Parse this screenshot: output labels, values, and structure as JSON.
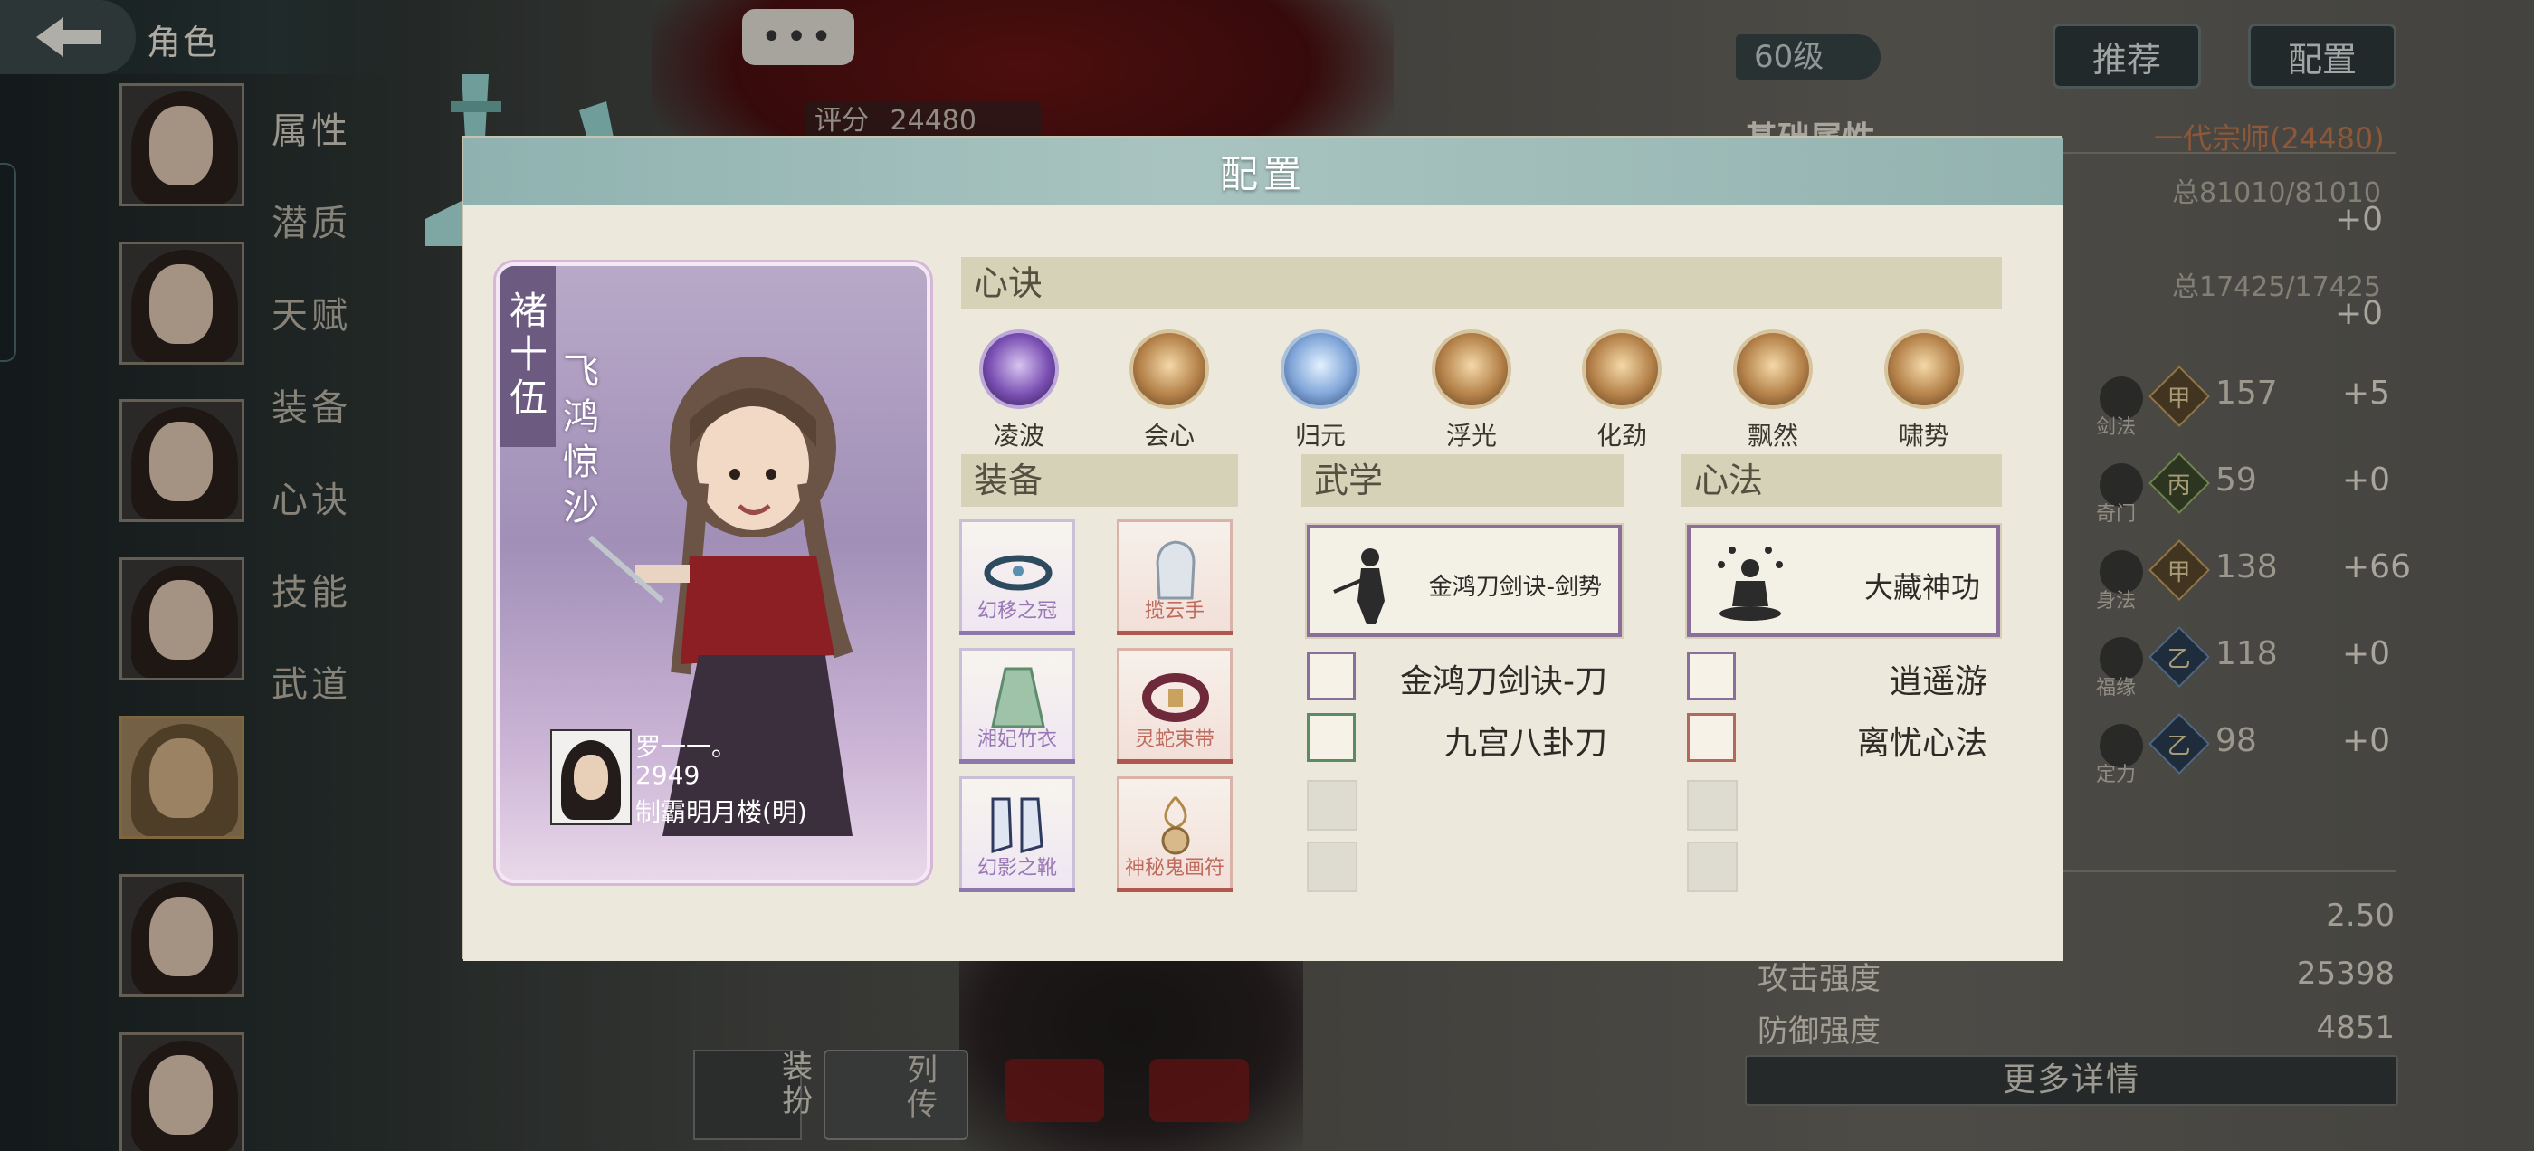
{
  "header": {
    "page_title": "角色",
    "back_icon": "back-arrow-icon",
    "chat_button": "•••",
    "score_label": "评分",
    "score_value": "24480"
  },
  "sidebar": {
    "menu": [
      "属性",
      "潜质",
      "天赋",
      "装备",
      "心诀",
      "技能",
      "武道"
    ]
  },
  "right_panel": {
    "level": "60级",
    "recommend_button": "推荐",
    "config_button": "配置",
    "base_attr_title": "基础属性",
    "rank": "一代宗师(24480)",
    "hp_total": "总81010/81010",
    "hp_bonus": "+0",
    "mp_total": "总17425/17425",
    "mp_bonus": "+0",
    "stats": [
      {
        "label": "剑法",
        "grade": "甲",
        "value": "157",
        "bonus": "+5",
        "grade_style": "gold"
      },
      {
        "label": "奇门",
        "grade": "丙",
        "value": "59",
        "bonus": "+0",
        "grade_style": "green"
      },
      {
        "label": "身法",
        "grade": "甲",
        "value": "138",
        "bonus": "+66",
        "grade_style": "gold"
      },
      {
        "label": "福缘",
        "grade": "乙",
        "value": "118",
        "bonus": "+0",
        "grade_style": "blue"
      },
      {
        "label": "定力",
        "grade": "乙",
        "value": "98",
        "bonus": "+0",
        "grade_style": "blue"
      }
    ],
    "bottom_attrs": [
      {
        "label": "",
        "value": "2.50"
      },
      {
        "label": "攻击强度",
        "value": "25398"
      },
      {
        "label": "防御强度",
        "value": "4851"
      }
    ],
    "more_details": "更多详情"
  },
  "bottom_buttons": {
    "dress_label": "装扮",
    "bio_label": "列传"
  },
  "modal": {
    "title": "配置",
    "character": {
      "name": "褚十伍",
      "title": "飞鸿惊沙",
      "owner_name": "罗一一。",
      "owner_power": "2949",
      "owner_guild": "制霸明月楼(明)"
    },
    "xinjue_section": "心诀",
    "xinjue": [
      {
        "label": "凌波",
        "style": "purple"
      },
      {
        "label": "会心",
        "style": "gold"
      },
      {
        "label": "归元",
        "style": "blue"
      },
      {
        "label": "浮光",
        "style": "gold"
      },
      {
        "label": "化劲",
        "style": "gold"
      },
      {
        "label": "飘然",
        "style": "gold"
      },
      {
        "label": "啸势",
        "style": "gold"
      }
    ],
    "equipment_section": "装备",
    "equipment": [
      {
        "name": "幻移之冠",
        "quality": "purple"
      },
      {
        "name": "揽云手",
        "quality": "red"
      },
      {
        "name": "湘妃竹衣",
        "quality": "purple"
      },
      {
        "name": "灵蛇束带",
        "quality": "red"
      },
      {
        "name": "幻影之靴",
        "quality": "purple"
      },
      {
        "name": "神秘鬼画符",
        "quality": "red"
      }
    ],
    "wuxue_section": "武学",
    "wuxue_main": "金鸿刀剑诀-剑势",
    "wuxue_subs": [
      "金鸿刀剑诀-刀",
      "九宫八卦刀"
    ],
    "xinfa_section": "心法",
    "xinfa_main": "大藏神功",
    "xinfa_subs": [
      "逍遥游",
      "离忧心法"
    ]
  }
}
